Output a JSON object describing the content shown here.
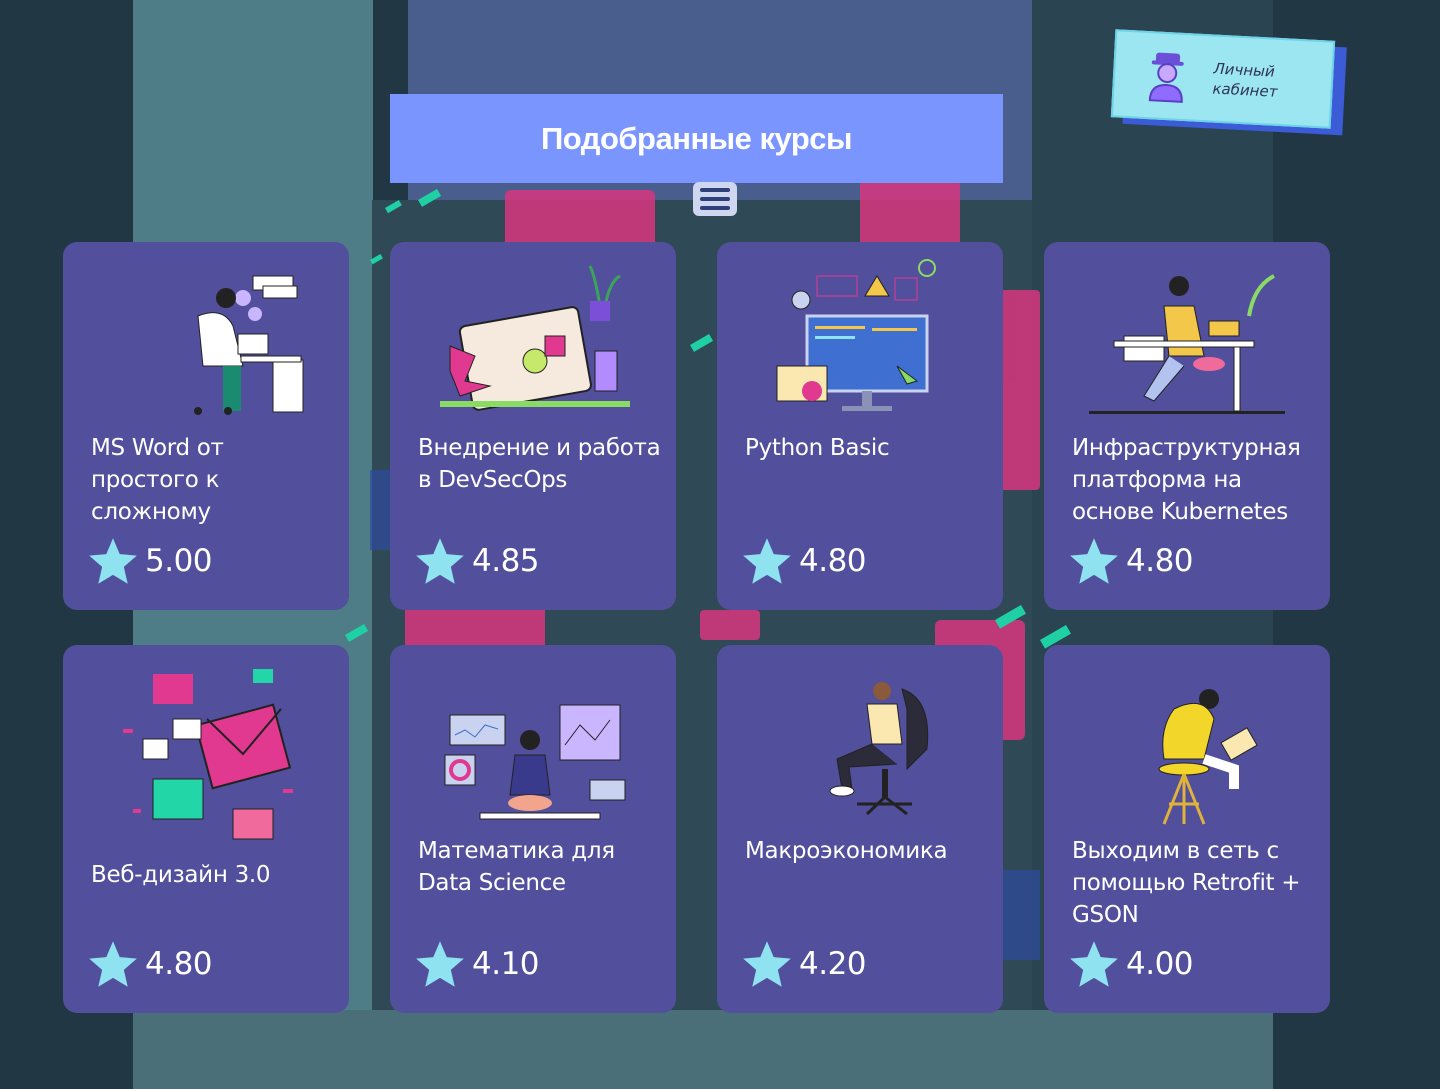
{
  "header": {
    "title": "Подобранные курсы",
    "menu_icon": "hamburger-menu-icon"
  },
  "cabinet": {
    "label": "Личный кабинет",
    "icon": "user-avatar-icon"
  },
  "courses": [
    {
      "title": "MS Word от простого к сложному",
      "rating": "5.00",
      "illustration": "person-at-desk-illustration"
    },
    {
      "title": "Внедрение и работа в DevSecOps",
      "rating": "4.85",
      "illustration": "laptop-stickers-illustration"
    },
    {
      "title": "Python Basic",
      "rating": "4.80",
      "illustration": "code-monitor-illustration"
    },
    {
      "title": "Инфраструктурная платформа на основе Kubernetes",
      "rating": "4.80",
      "illustration": "woman-at-desk-illustration"
    },
    {
      "title": "Веб-дизайн 3.0",
      "rating": "4.80",
      "illustration": "envelopes-illustration"
    },
    {
      "title": "Математика для Data Science",
      "rating": "4.10",
      "illustration": "analytics-dashboard-illustration"
    },
    {
      "title": "Макроэкономика",
      "rating": "4.20",
      "illustration": "person-in-chair-illustration"
    },
    {
      "title": "Выходим в сеть с помощью Retrofit + GSON",
      "rating": "4.00",
      "illustration": "person-on-stool-illustration"
    }
  ],
  "colors": {
    "background": "#223744",
    "card": "#524f9c",
    "title_bar": "#7b95ff",
    "star": "#8fe3f0",
    "cabinet": "#9ce6f2",
    "accent_pink": "#e0398f",
    "accent_teal": "#22d6a8"
  }
}
